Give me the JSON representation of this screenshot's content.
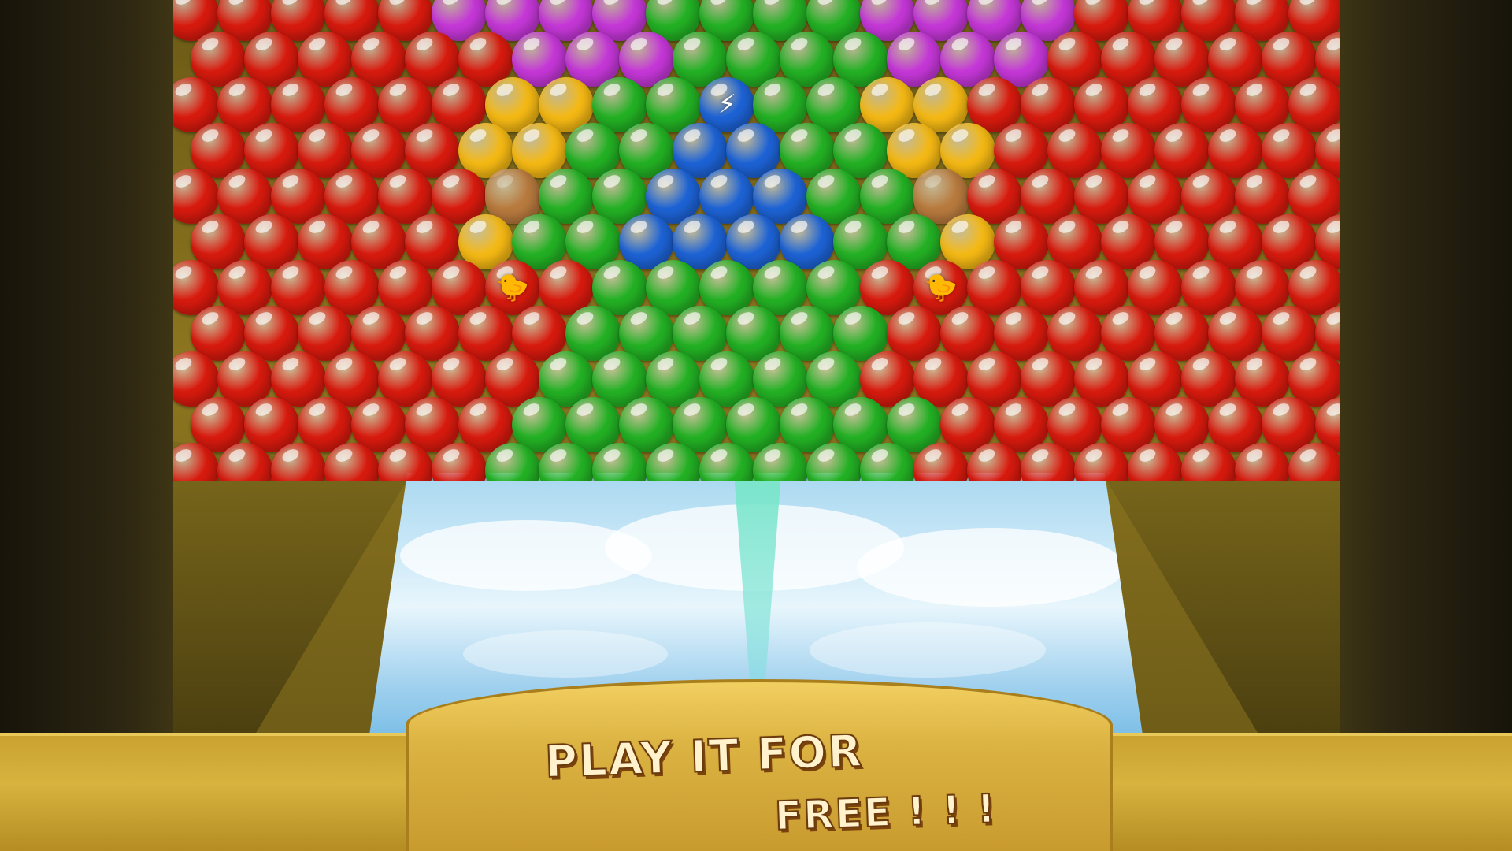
{
  "promo": {
    "line1": "PLAY IT FOR",
    "line2": "FREE ! ! !"
  },
  "palette": {
    "R": "#d81a0e",
    "O": "#f06a14",
    "Y": "#f5b914",
    "G": "#23b124",
    "B": "#1d63d6",
    "P": "#c537d8",
    "K": "#b87a3e",
    "L": "#1d63d6",
    "H": "#d81a0e"
  },
  "specials": {
    "K": "rock-bubble",
    "L": "lightning-bubble",
    "H": "bird-bubble"
  },
  "bubble_grid": [
    "RRRRRPPPPGGGGPPPPRRRRRR",
    "RRRRRRPPPGGGGPPPRRRRRRR",
    "RRRRRRYYGGLGGYYRRRRRRRR",
    "RRRRRYYGGBBGGYYRRRRRRR",
    "RRRRRRKGGBBBGGKRRRRRRRR",
    "RRRRRYGGBBBBGGYRRRRRRR",
    "RRRRRRHRGGGGGRHRRRRRRRR",
    "RRRRRRRGGGGGGRRRRRRRRR",
    "RRRRRRRGGGGGGRRRRRRRRRR",
    "RRRRRRGGGGGGGGRRRRRRRR",
    "RRRRRRGGGGGGGGRRRRRRRRR"
  ]
}
